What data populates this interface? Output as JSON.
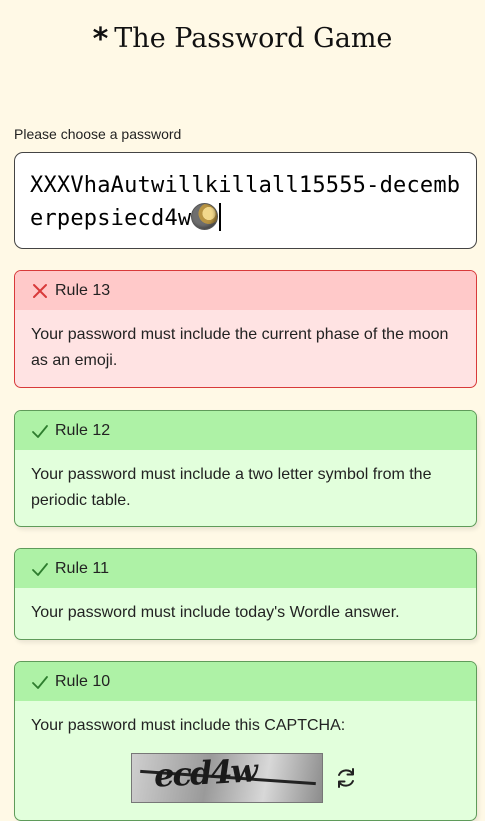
{
  "header": {
    "star": "*",
    "title": "The Password Game"
  },
  "password": {
    "label": "Please choose a password",
    "value": "XXXVhaAutwillkillall15555-decemberpepsiecd4w",
    "moon_icon": "waning-moon-emoji"
  },
  "rules": [
    {
      "status": "fail",
      "label": "Rule 13",
      "text": "Your password must include the current phase of the moon as an emoji."
    },
    {
      "status": "pass",
      "label": "Rule 12",
      "text": "Your password must include a two letter symbol from the periodic table."
    },
    {
      "status": "pass",
      "label": "Rule 11",
      "text": "Your password must include today's Wordle answer."
    },
    {
      "status": "pass",
      "label": "Rule 10",
      "text": "Your password must include this CAPTCHA:",
      "captcha": "ecd4w"
    }
  ],
  "colors": {
    "background": "#fff9e6",
    "fail_header": "#ffc9c9",
    "fail_body": "#ffe3e3",
    "fail_border": "#d83a3a",
    "pass_header": "#aef2a6",
    "pass_body": "#e2ffdc",
    "pass_border": "#5f9b5a"
  }
}
